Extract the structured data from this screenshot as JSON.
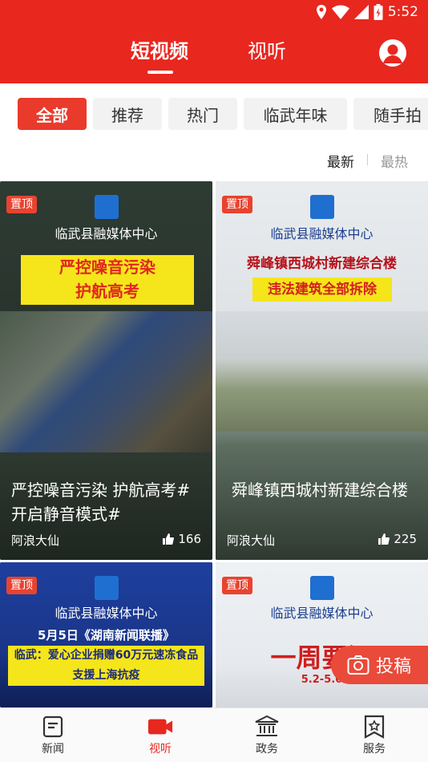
{
  "status": {
    "time": "5:52"
  },
  "header": {
    "tabs": [
      {
        "label": "短视频",
        "active": true
      },
      {
        "label": "视听",
        "active": false
      }
    ]
  },
  "categories": [
    {
      "label": "全部",
      "active": true
    },
    {
      "label": "推荐",
      "active": false
    },
    {
      "label": "热门",
      "active": false
    },
    {
      "label": "临武年味",
      "active": false
    },
    {
      "label": "随手拍",
      "active": false
    }
  ],
  "sort": {
    "latest": "最新",
    "hottest": "最热",
    "active": "最新"
  },
  "cards": [
    {
      "pin": "置顶",
      "org": "临武县融媒体中心",
      "banner_lines": [
        "严控噪音污染",
        "护航高考"
      ],
      "title": "严控噪音污染 护航高考# 开启静音模式#",
      "author": "阿浪大仙",
      "likes": "166"
    },
    {
      "pin": "置顶",
      "org": "临武县融媒体中心",
      "banner_top": "舜峰镇西城村新建综合楼",
      "banner_bottom": "违法建筑全部拆除",
      "title": "舜峰镇西城村新建综合楼",
      "author": "阿浪大仙",
      "likes": "225"
    },
    {
      "pin": "置顶",
      "org": "临武县融媒体中心",
      "subhead": "5月5日《湖南新闻联播》",
      "banner_lines": [
        "临武：爱心企业捐赠60万元速冻食品",
        "支援上海抗疫"
      ]
    },
    {
      "pin": "置顶",
      "org": "临武县融媒体中心",
      "banner": "一周要闻",
      "subline": "5.2-5.6"
    }
  ],
  "float_button": {
    "label": "投稿"
  },
  "bottom_nav": [
    {
      "label": "新闻",
      "icon": "news-icon",
      "active": false
    },
    {
      "label": "视听",
      "icon": "video-camera-icon",
      "active": true
    },
    {
      "label": "政务",
      "icon": "government-icon",
      "active": false
    },
    {
      "label": "服务",
      "icon": "service-icon",
      "active": false
    }
  ],
  "colors": {
    "brand_red": "#e8271f",
    "banner_yellow": "#f5e51b",
    "pin_red": "#e8432f"
  }
}
